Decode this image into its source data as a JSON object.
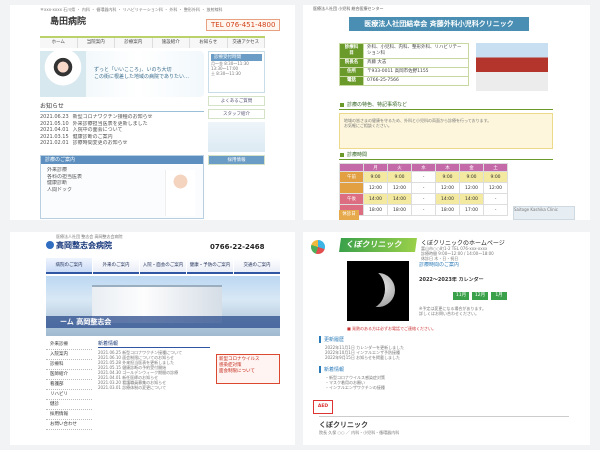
{
  "panel1": {
    "top_text": "〒xxx-xxxx 石川県 ・ 内科 ・ 循環器内科 ・ リハビリテーション科 ・ 外科 ・ 整形外科 ・ 放射線科",
    "site_title": "島田病院",
    "phone": "TEL 076-451-4800",
    "nav": [
      "ホーム",
      "当院案内",
      "診療案内",
      "施設紹介",
      "お知らせ",
      "交通アクセス"
    ],
    "hero_text_1": "ずっと「いいこころ」、いのち大切",
    "hero_text_2": "この街に根差した地域の病院でありたい…",
    "news_title": "お知らせ",
    "news": [
      {
        "date": "2021.06.23",
        "text": "新型コロナワクチン接種のお知らせ"
      },
      {
        "date": "2021.05.10",
        "text": "外来診療担当医表を更新しました"
      },
      {
        "date": "2021.04.01",
        "text": "入院中の面会について"
      },
      {
        "date": "2021.03.15",
        "text": "健康診断のご案内"
      },
      {
        "date": "2021.02.01",
        "text": "診療時間変更のお知らせ"
      }
    ],
    "box_head": "診療のご案内",
    "box_lines": [
      "外来診療",
      "各科の担当医表",
      "健康診断",
      "人間ドック"
    ],
    "side_head": "診療受付時間",
    "side_lines": [
      "月〜金 8:30〜11:30",
      "13:30〜17:00",
      "土 8:30〜11:30"
    ],
    "side_banners": [
      "よくあるご質問",
      "スタッフ紹介",
      "採用情報"
    ]
  },
  "panel2": {
    "top_text": "医療法人社団 小児科 総合医療センター",
    "title": "医療法人社団結幸会 斉藤外科小児科クリニック",
    "rows": [
      {
        "h": "診療科目",
        "v": "外科、小児科、内科、整形外科、リハビリテーション科"
      },
      {
        "h": "院長名",
        "v": "斉藤 大志"
      },
      {
        "h": "住所",
        "v": "〒933-0011 高岡市佐野1155"
      },
      {
        "h": "電話",
        "v": "0766-25-7566"
      }
    ],
    "sec1": "診療の特色、特記事項など",
    "note_lines": [
      "地域の皆さまの健康を守るため、外科と小児科の両面から診療を行っております。",
      "お気軽にご相談ください。"
    ],
    "sec2": "診療時間",
    "sched_head": [
      "",
      "月",
      "火",
      "水",
      "木",
      "金",
      "土"
    ],
    "sched": [
      {
        "label": "午前",
        "cls": "am",
        "v": [
          "9:00",
          "9:00",
          "-",
          "9:00",
          "9:00",
          "9:00"
        ]
      },
      {
        "label": "",
        "cls": "am",
        "v": [
          "12:00",
          "12:00",
          "-",
          "12:00",
          "12:00",
          "12:00"
        ]
      },
      {
        "label": "午後",
        "cls": "pm",
        "v": [
          "14:00",
          "14:00",
          "-",
          "14:00",
          "14:00",
          "-"
        ]
      },
      {
        "label": "",
        "cls": "pm",
        "v": [
          "18:00",
          "18:00",
          "-",
          "18:00",
          "17:00",
          "-"
        ]
      }
    ],
    "label": "休診日",
    "map_text": "Saitoge Kashika Clinic"
  },
  "panel3": {
    "small_top": "医療法人社団 整志会 高岡整志会病院",
    "logo": "高岡整志会病院",
    "phone": "0766-22-2468",
    "nav": [
      "病院のご案内",
      "外来のご案内",
      "入院・面会のご案内",
      "健康・予防のご案内",
      "交通のご案内"
    ],
    "band": "ーム 高岡整志会",
    "left_menu": [
      "外来診療",
      "入院案内",
      "診療科",
      "医師紹介",
      "看護部",
      "リハビリ",
      "健診",
      "採用情報",
      "お問い合わせ"
    ],
    "news_head": "新着情報",
    "news": [
      {
        "date": "2021.06.25",
        "text": "新型コロナワクチン接種について"
      },
      {
        "date": "2021.06.10",
        "text": "面会制限についてのお知らせ"
      },
      {
        "date": "2021.05.28",
        "text": "外来担当医表を更新しました"
      },
      {
        "date": "2021.05.15",
        "text": "健康診断の予約受付開始"
      },
      {
        "date": "2021.04.30",
        "text": "ゴールデンウィーク期間の診療"
      },
      {
        "date": "2021.04.01",
        "text": "新任医師のお知らせ"
      },
      {
        "date": "2021.03.20",
        "text": "看護職員募集のお知らせ"
      },
      {
        "date": "2021.03.01",
        "text": "診療体制の変更について"
      }
    ],
    "right_box": [
      "新型コロナウイルス",
      "感染症対策",
      "面会制限について"
    ]
  },
  "panel4": {
    "logo": "くぼクリニック",
    "home_title": "くぼクリニックのホームページ",
    "info_lines": [
      "富山市○○町1-2 TEL 076-xxx-xxxx",
      "診療時間 9:00〜12:00 / 14:00〜18:00",
      "休診日 木・日・祝日"
    ],
    "cal_title": "診療時間のご案内",
    "cal_sub": "2022〜2023年 カレンダー",
    "months": [
      "11月",
      "12月",
      "1月"
    ],
    "cal_lines": [
      "※予定は変更になる場合があります。",
      "詳しくはお問い合わせください。"
    ],
    "alert": "■ 発熱のある方は必ずお電話でご連絡ください。",
    "sec_update": "更新履歴",
    "updates": [
      {
        "date": "2022年11月1日",
        "text": "カレンダーを更新しました"
      },
      {
        "date": "2022年10月1日",
        "text": "インフルエンザ予防接種"
      },
      {
        "date": "2022年9月15日",
        "text": "お知らせを掲載しました"
      }
    ],
    "sec_news": "新着情報",
    "news_lines": [
      "・新型コロナウイルス感染症対策",
      "・マスク着用のお願い",
      "・インフルエンザワクチンの接種"
    ],
    "aed": "AED",
    "footer_title": "くぼクリニック",
    "footer_line": "院長 久保 ○○ ／ 内科・小児科・循環器内科"
  }
}
